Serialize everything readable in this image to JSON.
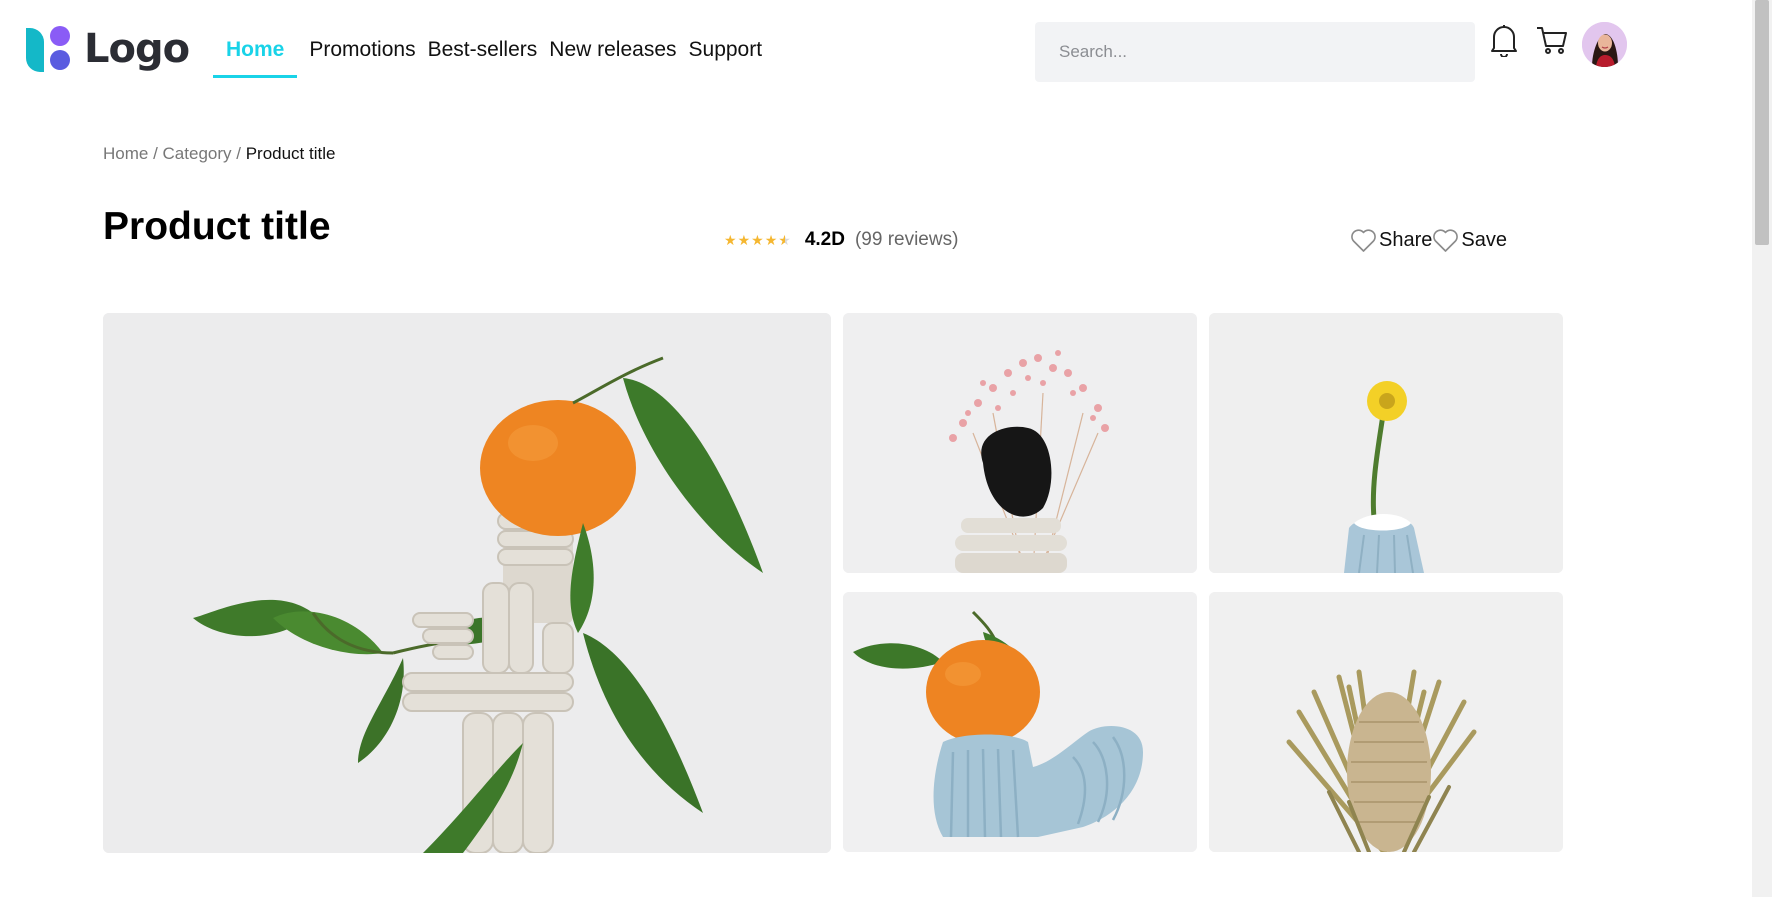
{
  "header": {
    "logo_text": "Logo",
    "nav": [
      {
        "label": "Home",
        "active": true
      },
      {
        "label": "Promotions",
        "active": false
      },
      {
        "label": "Best-sellers",
        "active": false
      },
      {
        "label": "New releases",
        "active": false
      },
      {
        "label": "Support",
        "active": false
      }
    ],
    "search": {
      "placeholder": "Search...",
      "value": ""
    },
    "icons": {
      "notifications": "bell-icon",
      "cart": "cart-icon",
      "avatar": "user-avatar"
    }
  },
  "breadcrumb": {
    "items": [
      "Home",
      "Category"
    ],
    "separator": " / ",
    "current": "Product title"
  },
  "product": {
    "title": "Product title",
    "rating": 4.2,
    "rating_label": "4.2D",
    "reviews_label": "(99 reviews)",
    "actions": [
      {
        "label": "Share",
        "icon": "heart-icon"
      },
      {
        "label": "Save",
        "icon": "heart-icon"
      }
    ]
  },
  "gallery": {
    "images": [
      {
        "subject": "orange on stacked clay sculpture with leaves"
      },
      {
        "subject": "pink dried flowers with black rock"
      },
      {
        "subject": "yellow flower in blue vase"
      },
      {
        "subject": "orange on blue clay sculpture"
      },
      {
        "subject": "dried banksia flower"
      }
    ]
  },
  "colors": {
    "accent": "#19d3e8",
    "star": "#f5b731",
    "logo_teal": "#14b8c8",
    "logo_purple": "#8a5cf6",
    "logo_blue": "#5a5ce0"
  }
}
